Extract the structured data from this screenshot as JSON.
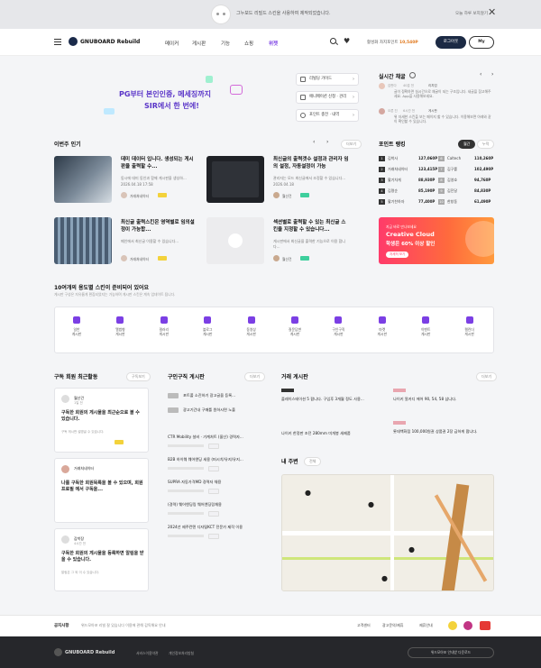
{
  "banner": {
    "message": "그누보드 리빌드 스킨을 사용하여 제작되었습니다.",
    "hide_today": "오늘 하루 보지않기"
  },
  "header": {
    "brand": "GNUBOARD Rebuild",
    "nav": [
      "메이커",
      "게시판",
      "기능",
      "쇼핑",
      "위젯"
    ],
    "points_label": "활성화 차지포인트",
    "points_value": "10,540P",
    "join": "로그아웃",
    "my": "My"
  },
  "hero": {
    "line1": "PG부터 본인인증, 메세징까지",
    "line2": "SIR에서 한 번에!",
    "guides": [
      "리빌딩 가이드",
      "애니메이션 신청 · 관리",
      "포인트 충전 · 내역"
    ]
  },
  "realtime": {
    "title": "실시간 채굴",
    "items": [
      {
        "user": "김판다",
        "time": "40분 전",
        "badge": "리치덤",
        "text": "글이 정확하면 실시간으로 채굴이 되는 구조입니다. 새글을 참고해주세요. App을 사용해보세요."
      },
      {
        "user": "오른 진",
        "time": "6시간 전",
        "badge": "게시판",
        "text": "위 자세한 스킨을 보는 페이지 할 수 있습니다. 이용해보면 아래와 같이 확인할 수 있습니다."
      }
    ]
  },
  "popular": {
    "title": "이번주 인기",
    "more": "더보기",
    "items": [
      {
        "title": "데미 데이터 입니다. 생성되는 게시판을 출력할 수...",
        "desc": "동시에 데미 동인과 함께 게시판을 생성하...",
        "date": "2026.04.18 17:58",
        "author": "거래처네이터"
      },
      {
        "title": "최신글의 출력갯수 설정과 관리자 임의 설정, 자동설정이 가능",
        "desc": "관리자는 모드 최신글에서 조정할 수 있습니다...",
        "date": "2026.04.18",
        "author": "월산건"
      },
      {
        "title": "최신글 출력스킨은 영역별로 임의설정이 가능합...",
        "desc": "메인에서 최신글 이용할 수 있습니다...",
        "date": "",
        "author": "거래처네이터"
      },
      {
        "title": "섹션별로 출력할 수 있는 최신글 스킨을 지정할 수 있습니다...",
        "desc": "게시판에서 최신글을 출력한 기능으로 이용 합니다...",
        "date": "",
        "author": "월산건"
      }
    ]
  },
  "ranking": {
    "title": "포인트 랭킹",
    "tabs": [
      "월간",
      "누적"
    ],
    "left": [
      [
        "1",
        "김박사",
        "127,060P"
      ],
      [
        "2",
        "거래처네이터",
        "123,415P"
      ],
      [
        "3",
        "활기차게",
        "88,930P"
      ],
      [
        "4",
        "김명순",
        "85,190P"
      ],
      [
        "5",
        "활기찬하자",
        "77,400P"
      ]
    ],
    "right": [
      [
        "6",
        "Caltech",
        "110,260P"
      ],
      [
        "7",
        "김구를",
        "102,490P"
      ],
      [
        "8",
        "김영호",
        "94,760P"
      ],
      [
        "9",
        "김진달",
        "84,830P"
      ],
      [
        "10",
        "한창동",
        "61,490P"
      ]
    ]
  },
  "promo": {
    "line1": "지금 바로 만나보세요",
    "line2": "Creative Cloud",
    "line3": "학생은 60% 이상 할인",
    "btn": "자세히 보기"
  },
  "skins": {
    "title": "10여개의 용도별 스킨이 준비되어 있어요",
    "subtitle": "게시판 구성은 자유롭게 편집되었지는 가능하며 게시판 스킨은 계속 업데이트 됩니다.",
    "items": [
      "일반\n게시판",
      "앨범형\n게시판",
      "갤러리\n게시판",
      "블로그\n게시판",
      "동영상\n게시판",
      "질문답변\n게시판",
      "구인구직\n게시판",
      "마켓\n게시판",
      "이벤트\n게시판",
      "캘린더\n게시판"
    ]
  },
  "sub": {
    "title": "구독 회원 최근활동",
    "more": "구독보기",
    "cards": [
      {
        "name": "월산건",
        "sub": "1일 전",
        "text": "구독한 회원의 게시물을 최근순으로 볼 수 있습니다.",
        "meta": "구독 게시판 설명글 수 있습니다."
      },
      {
        "name": "거래처네이터",
        "sub": "",
        "text": "나를 구독한 회원목록을 볼 수 있으며, 회원 프로필 에서 구독을...",
        "meta": ""
      },
      {
        "name": "감박장",
        "sub": "4시간 전",
        "text": "구독한 회원의 게시물을 등록하면 알림을 받을 수 있습니다.",
        "meta": "알림은 그 외 이 수 있습니다."
      }
    ]
  },
  "jobs": {
    "title": "구인구직 게시판",
    "more": "더보기",
    "items": [
      "포트폴 소진하기 광고글을 등록...",
      "광고기간내 구매를 원하시면 노출",
      "CTR Mobility 설비 · 가계처트 (울산) 경력자...",
      "B2B 하이웨 웨어엔딩 세용 (퍼시치/유지/유지...",
      "SUPRA 자동가격MD 경력자 채용",
      "(경력) 웨어엔딩링 웨어엔딩링채용",
      "2024년 제주컨텐 디자털KCT 전문가 제작 이용"
    ]
  },
  "market": {
    "title": "거래 게시판",
    "more": "더보기",
    "items": [
      "플레이스테이션 5 팝니다. 구입후 3개월 정도 사용...",
      "나이키 알카디 에어 90, 54, 58 삽니다.",
      "나이키 한정판 조던 280mm 미개봉 새제품",
      "롯데백화점 100,000원권 상품권 2장 급하게 팝니다."
    ]
  },
  "map": {
    "title": "내 주변",
    "select": "전체"
  },
  "footer": {
    "label": "공지사항",
    "notice": "위드모아포 리빌 잘 있습니다 이용에 관해 감독해요 안내",
    "links": [
      "고객센터",
      "광고문의/제휴",
      "제휴안내"
    ],
    "brand": "GNUBOARD Rebuild",
    "f1": "서비스이용약관",
    "f2": "개인정보처리방침",
    "dl": "위드모아포 안내받 다운로드"
  }
}
